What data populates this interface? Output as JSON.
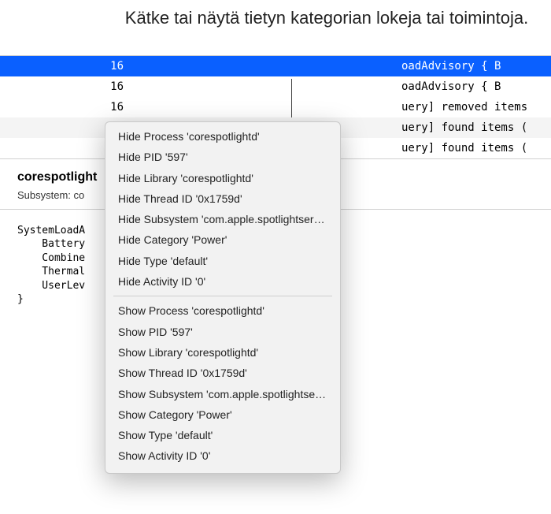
{
  "caption": "Kätke tai näytä tietyn kategorian lokeja tai toimintoja.",
  "log_rows": [
    {
      "time": "16",
      "msg": "oadAdvisory {     B",
      "selected": true,
      "alt": false
    },
    {
      "time": "16",
      "msg": "oadAdvisory {     B",
      "selected": false,
      "alt": false
    },
    {
      "time": "16",
      "msg": "uery] removed items",
      "selected": false,
      "alt": false
    },
    {
      "time": "16",
      "msg": "uery] found items (",
      "selected": false,
      "alt": true
    },
    {
      "time": "16",
      "msg": "uery] found items (",
      "selected": false,
      "alt": false
    }
  ],
  "details": {
    "title": "corespotlight",
    "subsystem_label": "Subsystem: co"
  },
  "body_text": "SystemLoadA\n    Battery\n    Combine\n    Thermal\n    UserLev\n}",
  "menu": {
    "hide": [
      "Hide Process 'corespotlightd'",
      "Hide PID '597'",
      "Hide Library 'corespotlightd'",
      "Hide Thread ID '0x1759d'",
      "Hide Subsystem 'com.apple.spotlightserver'",
      "Hide Category 'Power'",
      "Hide Type 'default'",
      "Hide Activity ID '0'"
    ],
    "show": [
      "Show Process 'corespotlightd'",
      "Show PID '597'",
      "Show Library 'corespotlightd'",
      "Show Thread ID '0x1759d'",
      "Show Subsystem 'com.apple.spotlightserver'",
      "Show Category 'Power'",
      "Show Type 'default'",
      "Show Activity ID '0'"
    ]
  }
}
